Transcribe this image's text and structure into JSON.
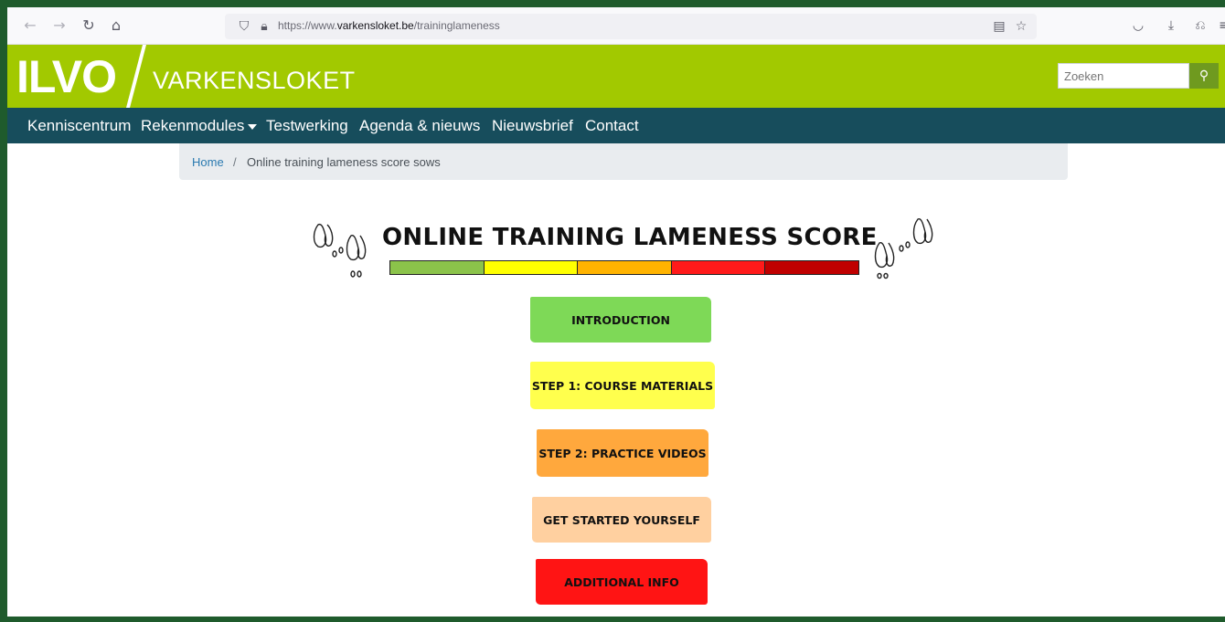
{
  "browser": {
    "back_icon": "arrow-left",
    "forward_icon": "arrow-right",
    "reload_icon": "reload",
    "home_icon": "home",
    "url_prefix": "https://www.",
    "url_domain": "varkensloket.be",
    "url_path": "/traininglameness"
  },
  "header": {
    "logo": "ILVO",
    "site_name": "VARKENSLOKET",
    "search_placeholder": "Zoeken",
    "brand_color": "#a2c900"
  },
  "nav": {
    "items": [
      {
        "label": "Kenniscentrum"
      },
      {
        "label": "Rekenmodules"
      },
      {
        "label": "Testwerking"
      },
      {
        "label": "Agenda & nieuws"
      },
      {
        "label": "Nieuwsbrief"
      },
      {
        "label": "Contact"
      }
    ]
  },
  "breadcrumb": {
    "home": "Home",
    "separator": "/",
    "current": "Online training lameness score sows"
  },
  "banner": {
    "title": "ONLINE TRAINING LAMENESS SCORE",
    "scale_colors": [
      "#8bc34a",
      "#ffff00",
      "#ffb300",
      "#ff1a1a",
      "#c00000"
    ]
  },
  "buttons": [
    {
      "label": "INTRODUCTION",
      "color": "#7ed957"
    },
    {
      "label": "STEP 1: COURSE MATERIALS",
      "color": "#ffff4d"
    },
    {
      "label": "STEP 2: PRACTICE VIDEOS",
      "color": "#ffa83d"
    },
    {
      "label": "GET STARTED YOURSELF",
      "color": "#ffd0a0"
    },
    {
      "label": "ADDITIONAL INFO",
      "color": "#ff1414"
    }
  ]
}
